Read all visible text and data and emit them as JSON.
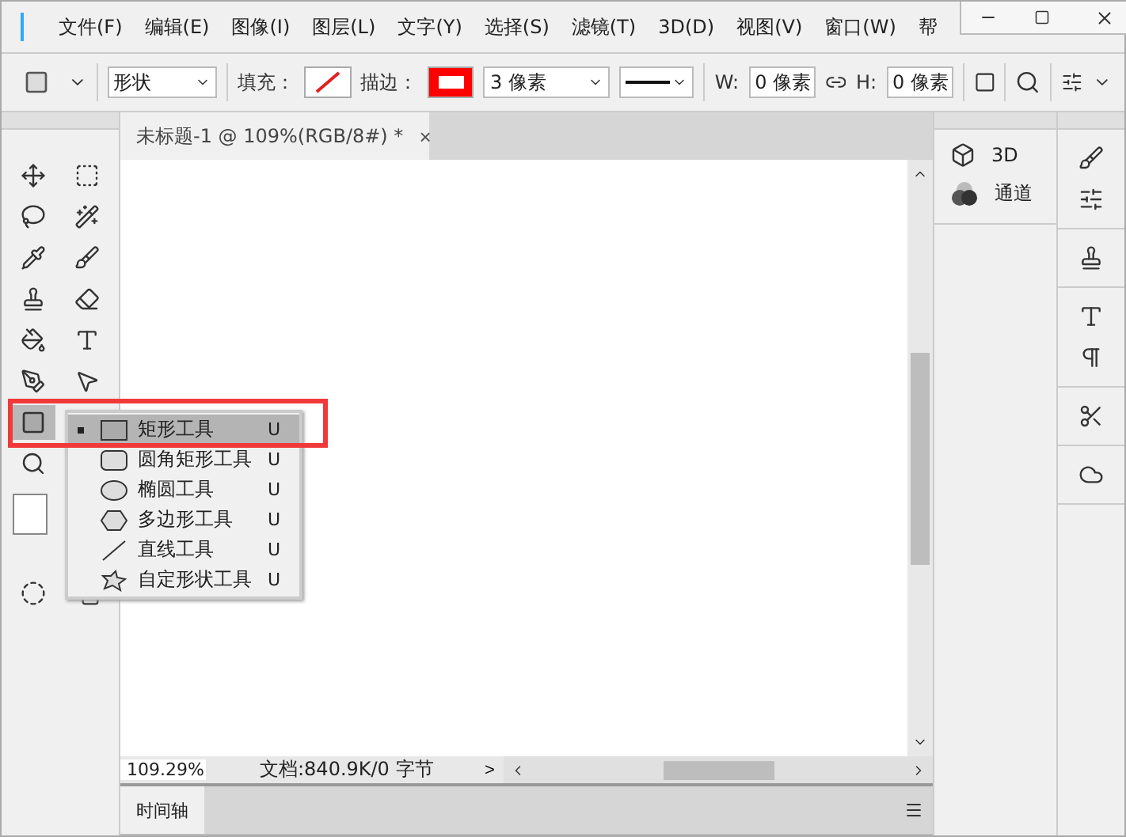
{
  "menu": [
    "文件(F)",
    "编辑(E)",
    "图像(I)",
    "图层(L)",
    "文字(Y)",
    "选择(S)",
    "滤镜(T)",
    "3D(D)",
    "视图(V)",
    "窗口(W)",
    "帮"
  ],
  "options": {
    "shape_mode": "形状",
    "fill_label": "填充：",
    "stroke_label": "描边：",
    "stroke_width": "3 像素",
    "w_label": "W:",
    "w_value": "0 像素",
    "h_label": "H:",
    "h_value": "0 像素"
  },
  "document_tab": {
    "title": "未标题-1 @ 109%(RGB/8#) *",
    "close": "×"
  },
  "flyout": [
    {
      "kind": "rect",
      "label": "矩形工具",
      "shortcut": "U",
      "selected": true,
      "annotated": true
    },
    {
      "kind": "rounded",
      "label": "圆角矩形工具",
      "shortcut": "U",
      "selected": false,
      "annotated": false
    },
    {
      "kind": "ellipse",
      "label": "椭圆工具",
      "shortcut": "U",
      "selected": false,
      "annotated": false
    },
    {
      "kind": "polygon",
      "label": "多边形工具",
      "shortcut": "U",
      "selected": false,
      "annotated": false
    },
    {
      "kind": "line",
      "label": "直线工具",
      "shortcut": "U",
      "selected": false,
      "annotated": false
    },
    {
      "kind": "custom",
      "label": "自定形状工具",
      "shortcut": "U",
      "selected": false,
      "annotated": false
    }
  ],
  "status": {
    "zoom": "109.29%",
    "doc_info": "文档:840.9K/0 字节",
    "arrow": ">"
  },
  "panels": [
    {
      "kind": "cube",
      "label": "3D"
    },
    {
      "kind": "channels",
      "label": "通道"
    }
  ],
  "timeline": {
    "label": "时间轴"
  }
}
